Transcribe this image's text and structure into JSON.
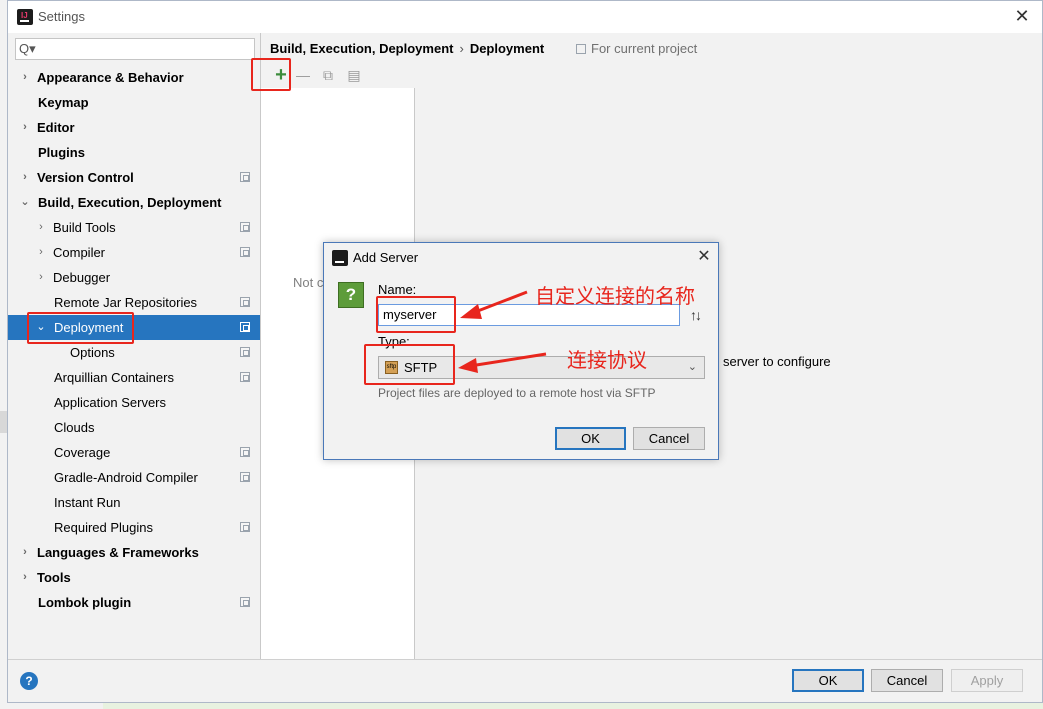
{
  "window": {
    "title": "Settings",
    "close_glyph": "✕"
  },
  "search": {
    "placeholder": "",
    "icon_glyph": "Q▾"
  },
  "tree": {
    "items": [
      {
        "label": "Appearance & Behavior",
        "arrow": "›"
      },
      {
        "label": "Keymap"
      },
      {
        "label": "Editor",
        "arrow": "›"
      },
      {
        "label": "Plugins"
      },
      {
        "label": "Version Control",
        "arrow": "›"
      },
      {
        "label": "Build, Execution, Deployment",
        "arrow": "⌄"
      },
      {
        "label": "Build Tools",
        "arrow": "›"
      },
      {
        "label": "Compiler",
        "arrow": "›"
      },
      {
        "label": "Debugger",
        "arrow": "›"
      },
      {
        "label": "Remote Jar Repositories"
      },
      {
        "label": "Deployment",
        "arrow": "⌄"
      },
      {
        "label": "Options"
      },
      {
        "label": "Arquillian Containers"
      },
      {
        "label": "Application Servers"
      },
      {
        "label": "Clouds"
      },
      {
        "label": "Coverage"
      },
      {
        "label": "Gradle-Android Compiler"
      },
      {
        "label": "Instant Run"
      },
      {
        "label": "Required Plugins"
      },
      {
        "label": "Languages & Frameworks",
        "arrow": "›"
      },
      {
        "label": "Tools",
        "arrow": "›"
      },
      {
        "label": "Lombok plugin"
      }
    ]
  },
  "header": {
    "crumb_parent": "Build, Execution, Deployment",
    "crumb_sep": "›",
    "crumb_current": "Deployment",
    "for_project": "For current project"
  },
  "servers": {
    "add_glyph": "+",
    "remove_glyph": "—",
    "copy_glyph": "⧉",
    "default_glyph": "▤",
    "empty_text": "Not c",
    "right_hint": "server to configure"
  },
  "dialog": {
    "title": "Add Server",
    "close_glyph": "✕",
    "help_glyph": "?",
    "name_label": "Name:",
    "name_value": "myserver",
    "sort_glyph": "↑↓",
    "type_label": "Type:",
    "type_value": "SFTP",
    "type_icon_text": "sftp",
    "type_arrow": "⌄",
    "type_description": "Project files are deployed to a remote host via SFTP",
    "ok": "OK",
    "cancel": "Cancel"
  },
  "footer": {
    "help_glyph": "?",
    "ok": "OK",
    "cancel": "Cancel",
    "apply": "Apply"
  },
  "annotations": {
    "name_note": "自定义连接的名称",
    "type_note": "连接协议",
    "color": "#e8261d"
  },
  "colors": {
    "selection": "#2675bf",
    "accent_green": "#3c8c3c"
  }
}
